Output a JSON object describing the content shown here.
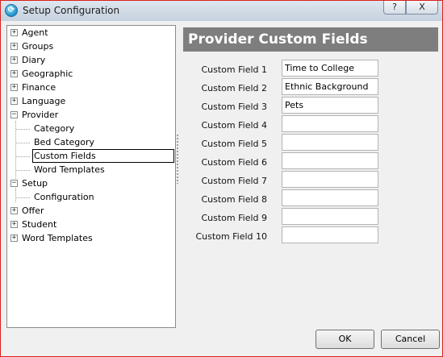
{
  "window": {
    "title": "Setup Configuration",
    "help_label": "?",
    "close_label": "X"
  },
  "tree": {
    "items": [
      {
        "label": "Agent",
        "expander": "+"
      },
      {
        "label": "Groups",
        "expander": "+"
      },
      {
        "label": "Diary",
        "expander": "+"
      },
      {
        "label": "Geographic",
        "expander": "+"
      },
      {
        "label": "Finance",
        "expander": "+"
      },
      {
        "label": "Language",
        "expander": "+"
      },
      {
        "label": "Provider",
        "expander": "−"
      },
      {
        "label": "Category"
      },
      {
        "label": "Bed Category"
      },
      {
        "label": "Custom Fields",
        "selected": true
      },
      {
        "label": "Word Templates"
      },
      {
        "label": "Setup",
        "expander": "−"
      },
      {
        "label": "Configuration"
      },
      {
        "label": "Offer",
        "expander": "+"
      },
      {
        "label": "Student",
        "expander": "+"
      },
      {
        "label": "Word Templates",
        "expander": "+"
      }
    ]
  },
  "panel": {
    "title": "Provider Custom Fields",
    "fields": [
      {
        "label": "Custom Field 1",
        "value": "Time to College"
      },
      {
        "label": "Custom Field 2",
        "value": "Ethnic Background"
      },
      {
        "label": "Custom Field 3",
        "value": "Pets"
      },
      {
        "label": "Custom Field 4",
        "value": ""
      },
      {
        "label": "Custom Field 5",
        "value": ""
      },
      {
        "label": "Custom Field 6",
        "value": ""
      },
      {
        "label": "Custom Field 7",
        "value": ""
      },
      {
        "label": "Custom Field 8",
        "value": ""
      },
      {
        "label": "Custom Field 9",
        "value": ""
      },
      {
        "label": "Custom Field 10",
        "value": ""
      }
    ]
  },
  "buttons": {
    "ok": "OK",
    "cancel": "Cancel"
  }
}
